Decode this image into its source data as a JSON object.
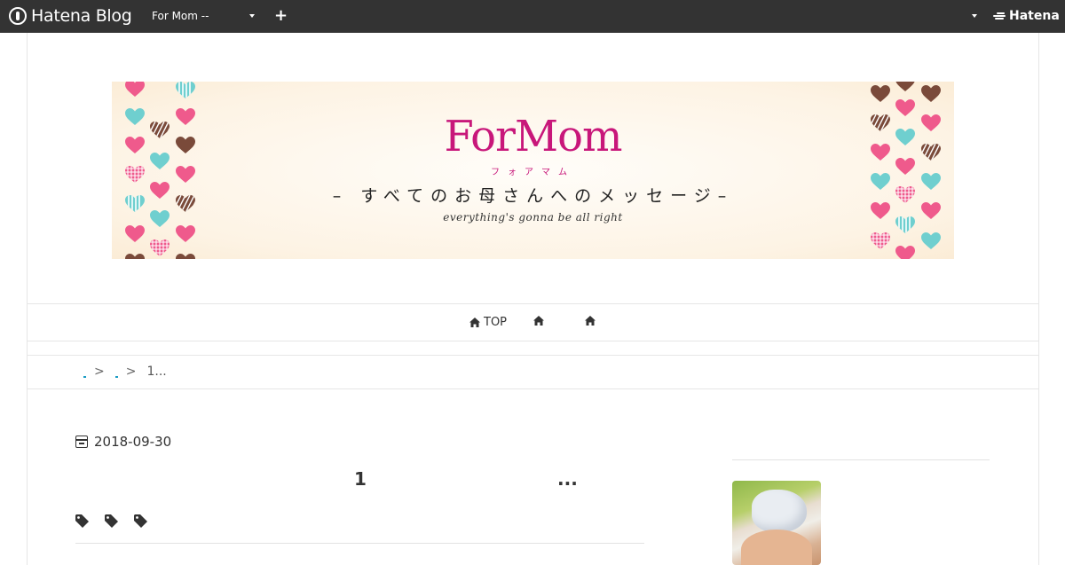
{
  "topbar": {
    "logo_text": "Hatena Blog",
    "blog_select_value": "For Mom --",
    "plus_label": "+",
    "brand": "Hatena"
  },
  "banner": {
    "title": "ForMom",
    "kana": "フォアマム",
    "subtitle": "– すべてのお母さんへのメッセージ–",
    "tagline": "everything's gonna be all right",
    "colors": {
      "title": "#c8177a",
      "pink_heart": "#ef5a8c",
      "teal_heart": "#6fcfcf",
      "brown_heart": "#7a4a3a"
    }
  },
  "nav": {
    "items": [
      {
        "label": "TOP",
        "icon": "home-icon"
      },
      {
        "label": "",
        "icon": "home-icon"
      },
      {
        "label": "",
        "icon": "home-icon"
      }
    ]
  },
  "breadcrumb": {
    "separator": ">",
    "current": "1..."
  },
  "entry": {
    "date": "2018-09-30",
    "title_part1": "1",
    "title_part2": "...",
    "tag_icons": [
      "tag-icon",
      "tag-icon",
      "tag-icon"
    ]
  },
  "colors": {
    "topbar_bg": "#333333",
    "link": "#1a9bc4",
    "border": "#e6e6e6"
  }
}
